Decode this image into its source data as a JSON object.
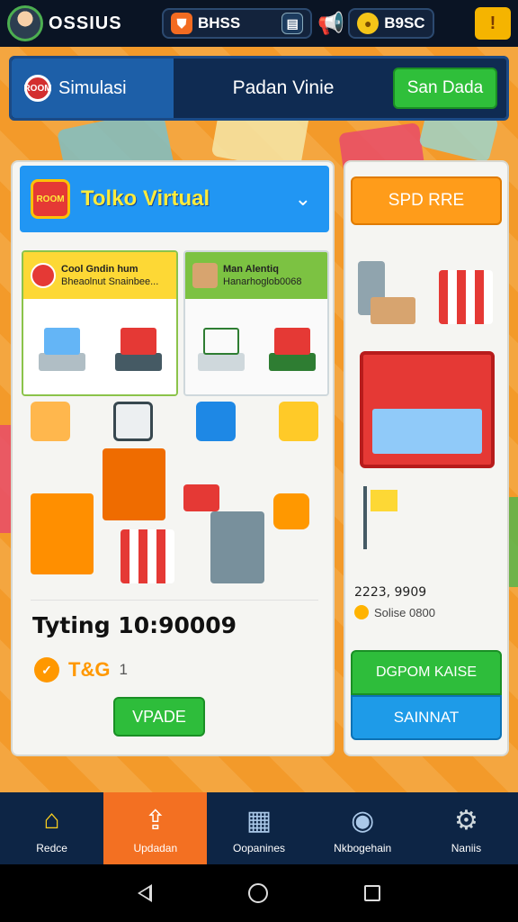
{
  "topbar": {
    "player_name": "OSSIUS",
    "resource1_value": "BHSS",
    "resource2_value": "B9SC",
    "alert_symbol": "!"
  },
  "header": {
    "tab_label": "Simulasi",
    "badge_text": "ROOM",
    "title": "Padan Vinie",
    "button_label": "San Dada"
  },
  "shop": {
    "title": "Tolko Virtual",
    "logo_text": "ROOM",
    "card1": {
      "line1": "Cool Gndin hum",
      "line2": "Bheaolnut Snainbee..."
    },
    "card2": {
      "line1": "Man Alentiq",
      "line2": "Hanarhoglob0068"
    }
  },
  "stats": {
    "big_value": "Tyting 10:90009",
    "level_label": "T&G",
    "level_num": "1",
    "update_button": "VPADE"
  },
  "right_panel": {
    "top_button": "SPD RRE",
    "stat1": "2223, 9909",
    "stat2": "Solise 0800",
    "green_button": "DGPOM KAISE",
    "blue_button": "SAINNAT"
  },
  "bottom_nav": [
    {
      "label": "Redce",
      "icon": "house-icon"
    },
    {
      "label": "Updadan",
      "icon": "update-icon"
    },
    {
      "label": "Oopanines",
      "icon": "operations-icon"
    },
    {
      "label": "Nkbogehain",
      "icon": "knowledge-icon"
    },
    {
      "label": "Naniis",
      "icon": "gear-icon"
    }
  ],
  "colors": {
    "accent_orange": "#f37022",
    "accent_green": "#2ebd3b",
    "accent_blue": "#2196f3",
    "nav_bg": "#0d2545"
  }
}
